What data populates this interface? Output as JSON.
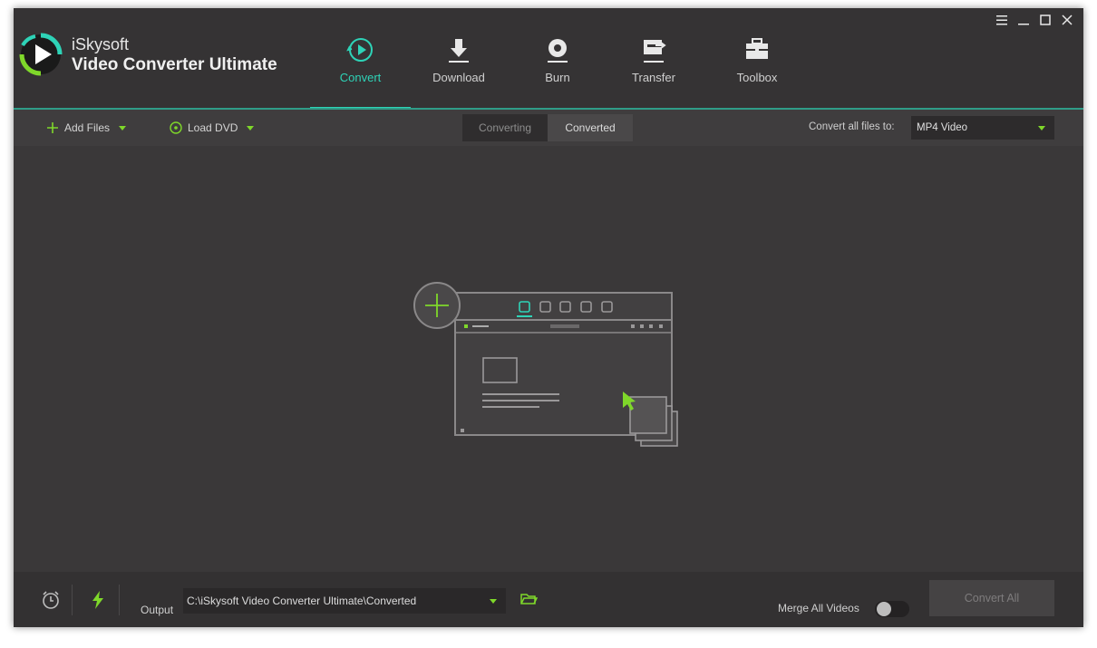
{
  "app": {
    "brand_line1": "iSkysoft",
    "brand_line2": "Video Converter Ultimate"
  },
  "nav": {
    "tabs": [
      {
        "label": "Convert",
        "icon": "convert-icon",
        "active": true
      },
      {
        "label": "Download",
        "icon": "download-icon",
        "active": false
      },
      {
        "label": "Burn",
        "icon": "burn-icon",
        "active": false
      },
      {
        "label": "Transfer",
        "icon": "transfer-icon",
        "active": false
      },
      {
        "label": "Toolbox",
        "icon": "toolbox-icon",
        "active": false
      }
    ]
  },
  "toolbar": {
    "add_files": "Add Files",
    "load_dvd": "Load DVD",
    "segments": [
      {
        "label": "Converting",
        "active": false
      },
      {
        "label": "Converted",
        "active": true
      }
    ],
    "convert_to_label": "Convert all files to:",
    "format_value": "MP4 Video"
  },
  "bottom": {
    "output_label": "Output",
    "output_path": "C:\\iSkysoft Video Converter Ultimate\\Converted",
    "merge_label": "Merge All Videos",
    "merge_enabled": false,
    "convert_all": "Convert All"
  },
  "colors": {
    "accent_teal": "#2ed3b7",
    "accent_green": "#7fd82a",
    "bg": "#3a3839"
  }
}
